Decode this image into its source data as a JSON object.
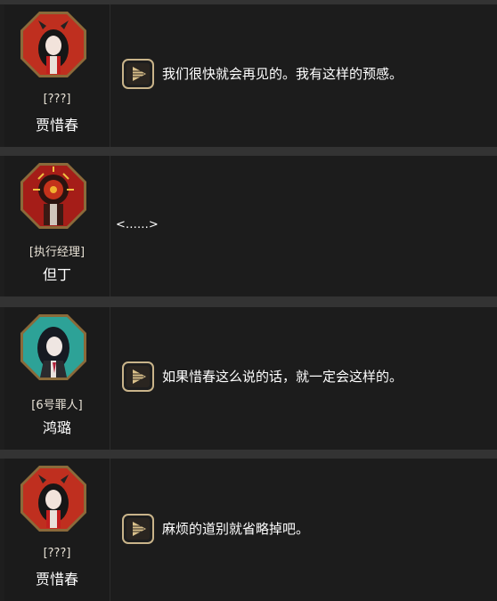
{
  "dialogue_log": [
    {
      "portrait": "jia-xichun-portrait",
      "title": "[???]",
      "name": "贾惜春",
      "has_voice": true,
      "text": "我们很快就会再见的。我有这样的预感。"
    },
    {
      "portrait": "dante-portrait",
      "title": "[执行经理]",
      "name": "但丁",
      "has_voice": false,
      "text": "<……>"
    },
    {
      "portrait": "hongluo-portrait",
      "title": "[6号罪人]",
      "name": "鸿璐",
      "has_voice": true,
      "text": "如果惜春这么说的话，就一定会这样的。"
    },
    {
      "portrait": "jia-xichun-portrait",
      "title": "[???]",
      "name": "贾惜春",
      "has_voice": true,
      "text": "麻烦的道别就省略掉吧。"
    }
  ],
  "colors": {
    "row_bg": "#1c1c1c",
    "divider": "#333333",
    "text": "#ffffff",
    "play_border": "#c9b48a"
  }
}
